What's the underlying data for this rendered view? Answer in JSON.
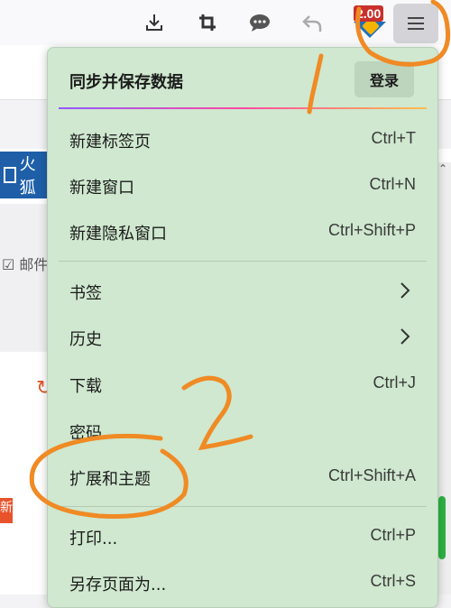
{
  "toolbar": {
    "extension_badge": "2.00",
    "icons": [
      "download-icon",
      "crop-icon",
      "chat-icon",
      "undo-icon",
      "extension-icon",
      "hamburger-menu-icon"
    ]
  },
  "background": {
    "tab_label_fragment": "火狐",
    "mail_fragment": "☑ 邮件",
    "new_badge_fragment": "新"
  },
  "menu": {
    "sync_title": "同步并保存数据",
    "login_label": "登录",
    "items": [
      {
        "label": "新建标签页",
        "shortcut": "Ctrl+T"
      },
      {
        "label": "新建窗口",
        "shortcut": "Ctrl+N"
      },
      {
        "label": "新建隐私窗口",
        "shortcut": "Ctrl+Shift+P"
      },
      {
        "label": "书签",
        "shortcut": ""
      },
      {
        "label": "历史",
        "shortcut": ""
      },
      {
        "label": "下载",
        "shortcut": "Ctrl+J"
      },
      {
        "label": "密码",
        "shortcut": ""
      },
      {
        "label": "扩展和主题",
        "shortcut": "Ctrl+Shift+A"
      },
      {
        "label": "打印...",
        "shortcut": "Ctrl+P"
      },
      {
        "label": "另存页面为...",
        "shortcut": "Ctrl+S"
      }
    ]
  },
  "annotations": {
    "step1": "1",
    "step2": "2",
    "color": "#f08a24"
  }
}
